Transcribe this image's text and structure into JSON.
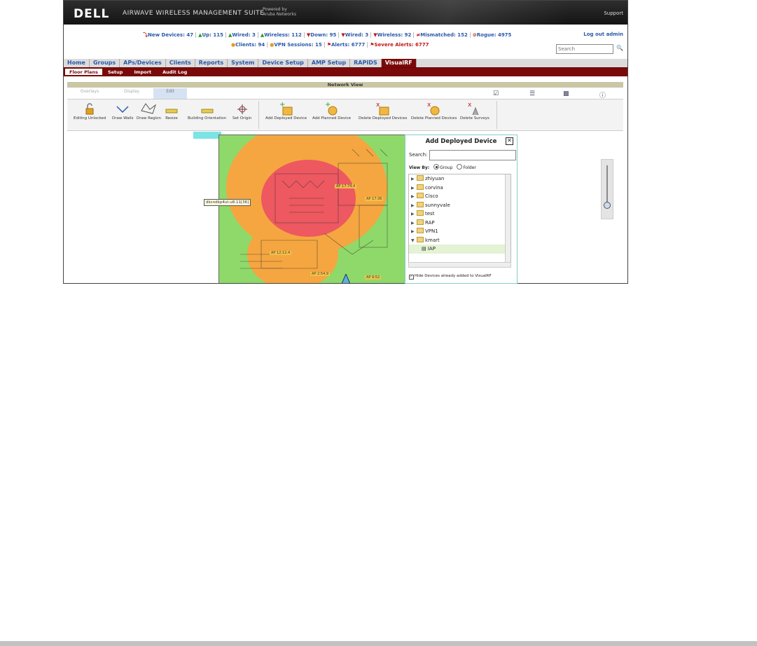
{
  "header": {
    "logo": "DELL",
    "suite": "AIRWAVE WIRELESS MANAGEMENT SUITE",
    "powered_line1": "Powered by",
    "powered_line2": "Aruba Networks",
    "support": "Support"
  },
  "stats": {
    "row1": [
      "New Devices: 47",
      "Up: 115",
      "Wired: 3",
      "Wireless: 112",
      "Down: 95",
      "Wired: 3",
      "Wireless: 92",
      "Mismatched: 152",
      "Rogue: 4975"
    ],
    "row2": [
      "Clients: 94",
      "VPN Sessions: 15",
      "Alerts: 6777",
      "Severe Alerts: 6777"
    ],
    "logout": "Log out admin",
    "search_placeholder": "Search"
  },
  "nav": {
    "tabs": [
      "Home",
      "Groups",
      "APs/Devices",
      "Clients",
      "Reports",
      "System",
      "Device Setup",
      "AMP Setup",
      "RAPIDS",
      "VisualRF"
    ],
    "active": "VisualRF",
    "subtabs": [
      "Floor Plans",
      "Setup",
      "Import",
      "Audit Log"
    ],
    "active_sub": "Floor Plans"
  },
  "network_view": {
    "title": "Network View",
    "view_tabs": [
      "Overlays",
      "Display",
      "Edit"
    ],
    "active_view": "Edit"
  },
  "toolbar": {
    "tools": [
      "Editing Unlocked",
      "Draw Walls",
      "Draw Region",
      "Resize",
      "Building Orientation",
      "Set Origin"
    ],
    "device_tools": [
      "Add Deployed Device",
      "Add Planned Device",
      "Delete Deployed Devices",
      "Delete Planned Devices",
      "Delete Surveys"
    ]
  },
  "map": {
    "tooltip": "dkcndkp4ut.u8.11[36]"
  },
  "dialog": {
    "title": "Add Deployed Device",
    "search_label": "Search:",
    "view_by_label": "View By:",
    "view_group": "Group",
    "view_folder": "Folder",
    "tree": [
      "zhiyuan",
      "corvina",
      "Cisco",
      "sunnyvale",
      "test",
      "RAP",
      "VPN1",
      "kmart"
    ],
    "child": "IAP",
    "hide_label": "Hide Devices already added to VisualRF"
  },
  "colors": {
    "brand_red": "#7a0a0a",
    "link_blue": "#2a5aa8",
    "coverage_green": "#8fd96a",
    "coverage_orange": "#f5a640",
    "coverage_red": "#ee5860"
  }
}
